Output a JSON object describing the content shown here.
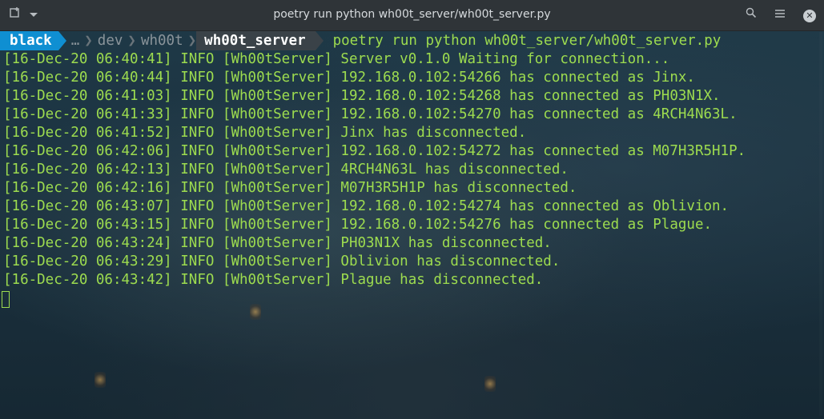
{
  "window": {
    "title": "poetry run python wh00t_server/wh00t_server.py",
    "icons": [
      "new-tab-icon",
      "dropdown-chevron-icon",
      "search-icon",
      "menu-icon",
      "close-icon"
    ]
  },
  "prompt": {
    "env": "black",
    "path": [
      "…",
      "dev",
      "wh00t"
    ],
    "current_dir": "wh00t_server",
    "command": "poetry run python wh00t_server/wh00t_server.py"
  },
  "log": [
    "[16-Dec-20 06:40:41] INFO [Wh00tServer] Server v0.1.0 Waiting for connection...",
    "[16-Dec-20 06:40:44] INFO [Wh00tServer] 192.168.0.102:54266 has connected as Jinx.",
    "[16-Dec-20 06:41:03] INFO [Wh00tServer] 192.168.0.102:54268 has connected as PH03N1X.",
    "[16-Dec-20 06:41:33] INFO [Wh00tServer] 192.168.0.102:54270 has connected as 4RCH4N63L.",
    "[16-Dec-20 06:41:52] INFO [Wh00tServer] Jinx has disconnected.",
    "[16-Dec-20 06:42:06] INFO [Wh00tServer] 192.168.0.102:54272 has connected as M07H3R5H1P.",
    "[16-Dec-20 06:42:13] INFO [Wh00tServer] 4RCH4N63L has disconnected.",
    "[16-Dec-20 06:42:16] INFO [Wh00tServer] M07H3R5H1P has disconnected.",
    "[16-Dec-20 06:43:07] INFO [Wh00tServer] 192.168.0.102:54274 has connected as Oblivion.",
    "[16-Dec-20 06:43:15] INFO [Wh00tServer] 192.168.0.102:54276 has connected as Plague.",
    "[16-Dec-20 06:43:24] INFO [Wh00tServer] PH03N1X has disconnected.",
    "[16-Dec-20 06:43:29] INFO [Wh00tServer] Oblivion has disconnected.",
    "[16-Dec-20 06:43:42] INFO [Wh00tServer] Plague has disconnected."
  ],
  "colors": {
    "text": "#9ddc4f",
    "prompt_env_bg": "#0f8fd2",
    "titlebar_bg": "#2f3438"
  }
}
